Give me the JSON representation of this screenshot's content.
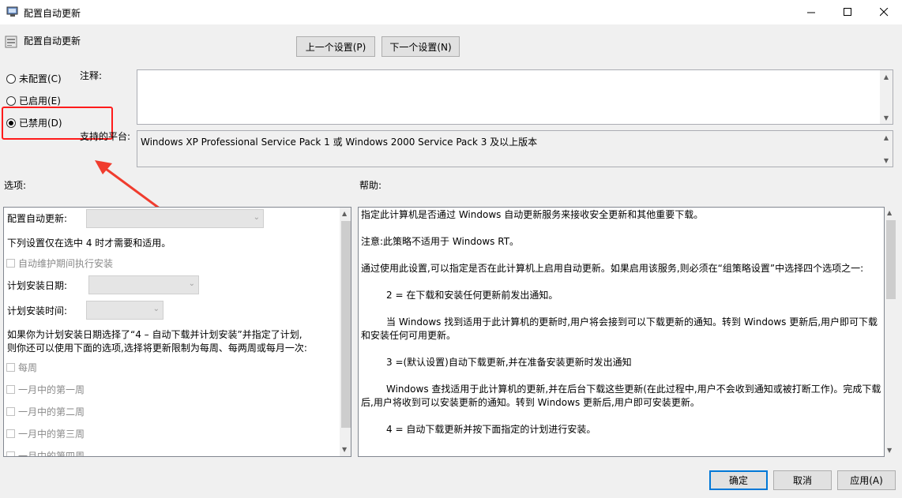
{
  "window": {
    "title": "配置自动更新"
  },
  "header": {
    "policy_title": "配置自动更新",
    "prev_label": "上一个设置(P)",
    "next_label": "下一个设置(N)"
  },
  "state_options": [
    {
      "label": "未配置(C)",
      "checked": false
    },
    {
      "label": "已启用(E)",
      "checked": false
    },
    {
      "label": "已禁用(D)",
      "checked": true
    }
  ],
  "comment": {
    "label": "注释:",
    "value": ""
  },
  "platform": {
    "label": "支持的平台:",
    "value": "Windows XP Professional Service Pack 1 或 Windows 2000 Service Pack 3 及以上版本"
  },
  "options": {
    "section_label": "选项:",
    "configure_label": "配置自动更新:",
    "note": "下列设置仅在选中 4 时才需要和适用。",
    "maintenance_checkbox": "自动维护期间执行安装",
    "schedule_day_label": "计划安装日期:",
    "schedule_time_label": "计划安装时间:",
    "week_note_line1": "如果你为计划安装日期选择了“4 – 自动下载并计划安装”并指定了计划,",
    "week_note_line2": "则你还可以使用下面的选项,选择将更新限制为每周、每两周或每月一次:",
    "weekly_checkboxes": [
      "每周",
      "一月中的第一周",
      "一月中的第二周",
      "一月中的第三周",
      "一月中的第四周"
    ]
  },
  "help": {
    "section_label": "帮助:",
    "paragraphs": [
      "指定此计算机是否通过 Windows 自动更新服务来接收安全更新和其他重要下载。",
      "注意:此策略不适用于 Windows RT。",
      "通过使用此设置,可以指定是否在此计算机上启用自动更新。如果启用该服务,则必须在“组策略设置”中选择四个选项之一:",
      "2 = 在下载和安装任何更新前发出通知。",
      "当 Windows 找到适用于此计算机的更新时,用户将会接到可以下载更新的通知。转到 Windows 更新后,用户即可下载和安装任何可用更新。",
      "3 =(默认设置)自动下载更新,并在准备安装更新时发出通知",
      "Windows 查找适用于此计算机的更新,并在后台下载这些更新(在此过程中,用户不会收到通知或被打断工作)。完成下载后,用户将收到可以安装更新的通知。转到 Windows 更新后,用户即可安装更新。",
      "4 = 自动下载更新并按下面指定的计划进行安装。"
    ]
  },
  "footer": {
    "ok_label": "确定",
    "cancel_label": "取消",
    "apply_label": "应用(A)"
  },
  "colors": {
    "highlight": "#ff1b1b",
    "accent": "#0078d7"
  }
}
